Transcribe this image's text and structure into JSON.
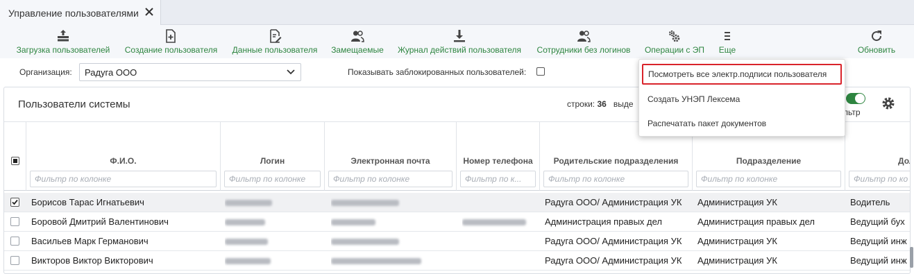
{
  "tab": {
    "title": "Управление пользователями"
  },
  "toolbar": {
    "buttons": [
      {
        "label": "Загрузка пользователей",
        "icon": "upload-users-icon"
      },
      {
        "label": "Создание пользователя",
        "icon": "create-file-icon"
      },
      {
        "label": "Данные пользователя",
        "icon": "edit-file-icon"
      },
      {
        "label": "Замещаемые",
        "icon": "users-icon"
      },
      {
        "label": "Журнал действий пользователя",
        "icon": "download-icon"
      },
      {
        "label": "Сотрудники без логинов",
        "icon": "users-icon"
      },
      {
        "label": "Операции с ЭП",
        "icon": "gears-icon"
      },
      {
        "label": "Еще",
        "icon": "menu-icon"
      },
      {
        "label": "Обновить",
        "icon": "refresh-icon"
      }
    ]
  },
  "filters": {
    "org_label": "Организация:",
    "org_value": "Радуга ООО",
    "blocked_label": "Показывать заблокированных пользователей:"
  },
  "panel": {
    "title": "Пользователи системы",
    "rows_label": "строки:",
    "rows_count": "36",
    "selected_label": "выде",
    "filter_label": "льтр"
  },
  "grid": {
    "columns": [
      {
        "label": "Ф.И.О."
      },
      {
        "label": "Логин"
      },
      {
        "label": "Электронная почта"
      },
      {
        "label": "Номер телефона"
      },
      {
        "label": "Родительские подразделения"
      },
      {
        "label": "Подразделение"
      },
      {
        "label": "Дол"
      }
    ],
    "filter_placeholders": [
      "Фильтр по колонке",
      "Фильтр по колонке",
      "Фильтр по колонке",
      "Фильтр по к...",
      "Фильтр по колонке",
      "Фильтр по колонке",
      "Фильтр по ко"
    ],
    "rows": [
      {
        "name": "Борисов Тарас Игнатьевич",
        "parent": "Радуга ООО/ Администрация УК",
        "dept": "Администрация УК",
        "position": "Водитель",
        "checked": true
      },
      {
        "name": "Боровой Дмитрий Валентинович",
        "parent": "Администрация правых дел",
        "dept": "Администрация правых дел",
        "position": "Ведущий бух",
        "checked": false
      },
      {
        "name": "Васильев Марк Германович",
        "parent": "Радуга ООО/ Администрация УК",
        "dept": "Администрация УК",
        "position": "Ведущий инж",
        "checked": false
      },
      {
        "name": "Викторов Виктор Викторович",
        "parent": "Радуга ООО/ Администрация УК",
        "dept": "Администрация УК",
        "position": "Ведущий инж",
        "checked": false
      }
    ]
  },
  "dropdown": {
    "items": [
      "Посмотреть все электр.подписи пользователя",
      "Создать УНЭП Лексема",
      "Распечатать пакет документов"
    ]
  },
  "colors": {
    "accent": "#2e8540",
    "highlight": "#d9232a"
  }
}
